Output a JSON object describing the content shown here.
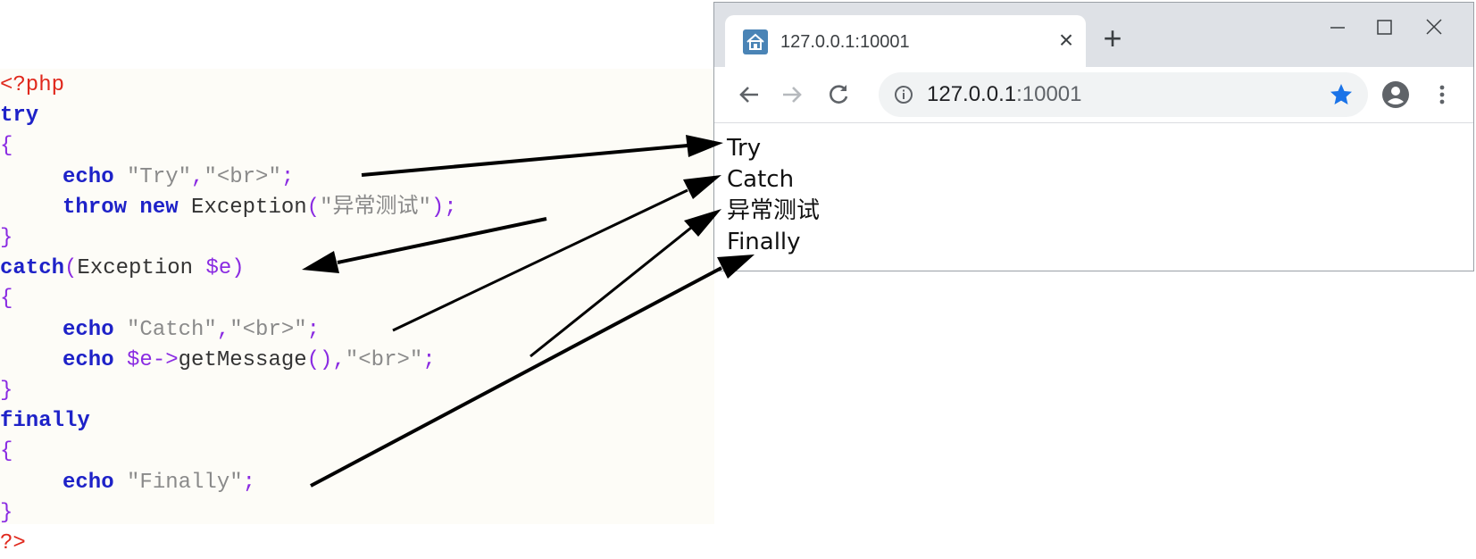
{
  "code": {
    "lines": [
      [
        {
          "t": "<?php",
          "c": "tag"
        }
      ],
      [
        {
          "t": "try",
          "c": "kw"
        }
      ],
      [
        {
          "t": "{",
          "c": "op"
        }
      ],
      [
        {
          "t": "echo",
          "c": "kw",
          "i": true
        },
        {
          "t": " ",
          "c": "id"
        },
        {
          "t": "\"Try\"",
          "c": "str"
        },
        {
          "t": ",",
          "c": "op"
        },
        {
          "t": "\"<br>\"",
          "c": "str"
        },
        {
          "t": ";",
          "c": "op"
        }
      ],
      [
        {
          "t": "throw",
          "c": "kw",
          "i": true
        },
        {
          "t": " ",
          "c": "id"
        },
        {
          "t": "new",
          "c": "kw"
        },
        {
          "t": " Exception",
          "c": "id"
        },
        {
          "t": "(",
          "c": "op"
        },
        {
          "t": "\"异常测试\"",
          "c": "str"
        },
        {
          "t": ");",
          "c": "op"
        }
      ],
      [
        {
          "t": "}",
          "c": "op"
        }
      ],
      [
        {
          "t": "catch",
          "c": "kw"
        },
        {
          "t": "(",
          "c": "op"
        },
        {
          "t": "Exception ",
          "c": "id"
        },
        {
          "t": "$e",
          "c": "op"
        },
        {
          "t": ")",
          "c": "op"
        }
      ],
      [
        {
          "t": "{",
          "c": "op"
        }
      ],
      [
        {
          "t": "echo",
          "c": "kw",
          "i": true
        },
        {
          "t": " ",
          "c": "id"
        },
        {
          "t": "\"Catch\"",
          "c": "str"
        },
        {
          "t": ",",
          "c": "op"
        },
        {
          "t": "\"<br>\"",
          "c": "str"
        },
        {
          "t": ";",
          "c": "op"
        }
      ],
      [
        {
          "t": "echo",
          "c": "kw",
          "i": true
        },
        {
          "t": " ",
          "c": "id"
        },
        {
          "t": "$e->",
          "c": "op"
        },
        {
          "t": "getMessage",
          "c": "id"
        },
        {
          "t": "(),",
          "c": "op"
        },
        {
          "t": "\"<br>\"",
          "c": "str"
        },
        {
          "t": ";",
          "c": "op"
        }
      ],
      [
        {
          "t": "}",
          "c": "op"
        }
      ],
      [
        {
          "t": "finally",
          "c": "kw"
        }
      ],
      [
        {
          "t": "{",
          "c": "op"
        }
      ],
      [
        {
          "t": "echo",
          "c": "kw",
          "i": true
        },
        {
          "t": " ",
          "c": "id"
        },
        {
          "t": "\"Finally\"",
          "c": "str"
        },
        {
          "t": ";",
          "c": "op"
        }
      ],
      [
        {
          "t": "}",
          "c": "op"
        }
      ],
      [
        {
          "t": "?>",
          "c": "tag"
        }
      ]
    ]
  },
  "browser": {
    "tab_title": "127.0.0.1:10001",
    "tab_close_label": "×",
    "new_tab_label": "+",
    "url_host": "127.0.0.1",
    "url_port": ":10001",
    "icons": {
      "favicon": "home-icon",
      "back": "arrow-left-icon",
      "forward": "arrow-right-icon",
      "reload": "reload-icon",
      "info": "info-icon",
      "bookmark": "star-icon",
      "profile": "account-icon",
      "menu": "kebab-menu-icon"
    },
    "colors": {
      "bookmark_star": "#1a73e8",
      "tabstrip": "#dee1e6",
      "favicon": "#4a84b6"
    },
    "output_lines": [
      "Try",
      "Catch",
      "异常测试",
      "Finally"
    ]
  },
  "arrows": [
    {
      "from": "echo \"Try\"",
      "to": "Try"
    },
    {
      "from": "throw new Exception(\"异常测试\")",
      "to": "catch(Exception $e)"
    },
    {
      "from": "echo \"Catch\"",
      "to": "Catch"
    },
    {
      "from": "echo $e->getMessage()",
      "to": "异常测试"
    },
    {
      "from": "echo \"Finally\"",
      "to": "Finally"
    }
  ]
}
